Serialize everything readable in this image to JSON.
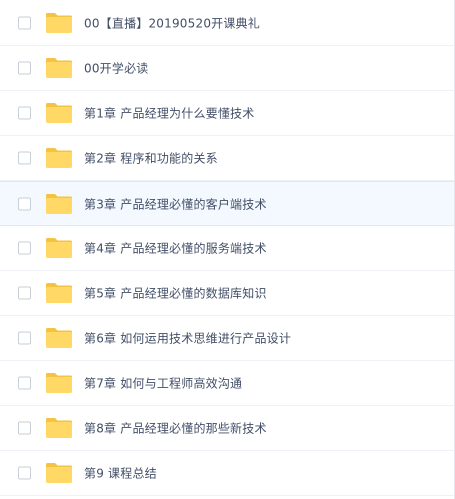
{
  "file_list": {
    "items": [
      {
        "name": "00【直播】20190520开课典礼"
      },
      {
        "name": "00开学必读"
      },
      {
        "name": "第1章 产品经理为什么要懂技术"
      },
      {
        "name": "第2章 程序和功能的关系"
      },
      {
        "name": "第3章 产品经理必懂的客户端技术",
        "highlighted": true
      },
      {
        "name": "第4章 产品经理必懂的服务端技术"
      },
      {
        "name": "第5章 产品经理必懂的数据库知识"
      },
      {
        "name": "第6章 如何运用技术思维进行产品设计"
      },
      {
        "name": "第7章 如何与工程师高效沟通"
      },
      {
        "name": "第8章 产品经理必懂的那些新技术"
      },
      {
        "name": "第9 课程总结"
      }
    ]
  },
  "colors": {
    "folder_body": "#ffd866",
    "folder_tab": "#f5c343",
    "text": "#424e67",
    "highlight_bg": "#f3f9ff"
  },
  "icons": {
    "item_icon": "folder-icon"
  }
}
